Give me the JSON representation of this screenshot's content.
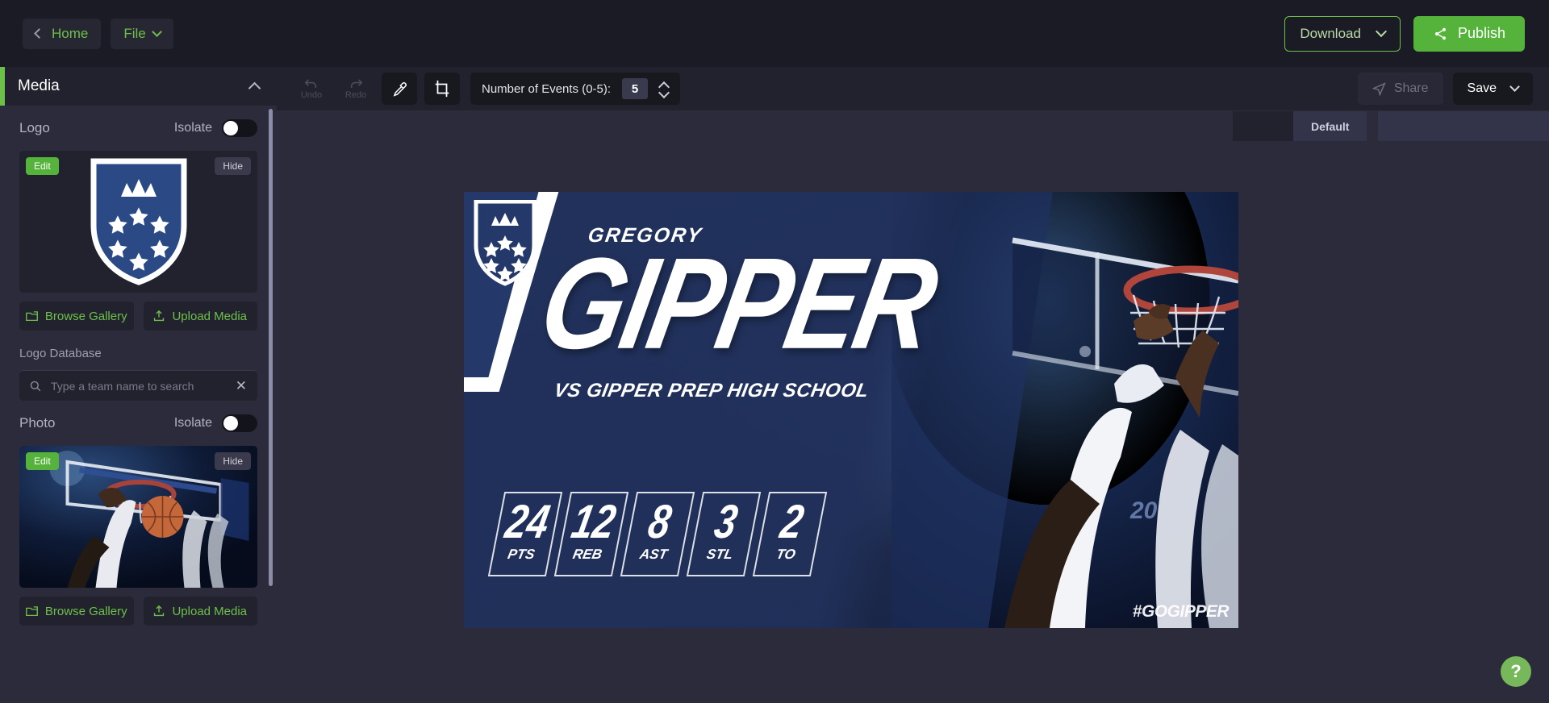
{
  "topbar": {
    "back_label": "Home",
    "file_label": "File",
    "download_label": "Download",
    "publish_label": "Publish"
  },
  "sidebar": {
    "panel_title": "Media",
    "logo": {
      "label": "Logo",
      "isolate_label": "Isolate",
      "isolate_on": false,
      "edit_label": "Edit",
      "hide_label": "Hide",
      "browse_label": "Browse Gallery",
      "upload_label": "Upload Media"
    },
    "logo_database": {
      "label": "Logo Database",
      "search_placeholder": "Type a team name to search",
      "search_value": ""
    },
    "photo": {
      "label": "Photo",
      "isolate_label": "Isolate",
      "isolate_on": false,
      "edit_label": "Edit",
      "hide_label": "Hide",
      "browse_label": "Browse Gallery",
      "upload_label": "Upload Media"
    }
  },
  "toolbar": {
    "undo_label": "Undo",
    "redo_label": "Redo",
    "eyedropper_name": "eyedropper-icon",
    "crop_name": "crop-icon",
    "events_label": "Number of Events (0-5):",
    "events_value": "5",
    "share_label": "Share",
    "save_label": "Save"
  },
  "canvas": {
    "tab_label": "Default",
    "artwork": {
      "first_name": "GREGORY",
      "last_name": "GIPPER",
      "subtitle": "VS GIPPER PREP HIGH SCHOOL",
      "watermark": "#GOGIPPER",
      "stats": [
        {
          "value": "24",
          "key": "PTS"
        },
        {
          "value": "12",
          "key": "REB"
        },
        {
          "value": "8",
          "key": "AST"
        },
        {
          "value": "3",
          "key": "STL"
        },
        {
          "value": "2",
          "key": "TO"
        }
      ]
    }
  },
  "help": {
    "label": "?"
  },
  "colors": {
    "accent_green": "#6cc04a",
    "publish_green": "#55b33b",
    "bg_dark": "#1b1b26",
    "panel": "#2b2b3b",
    "panel_dark": "#22222e",
    "artwork_navy": "#25386a"
  }
}
